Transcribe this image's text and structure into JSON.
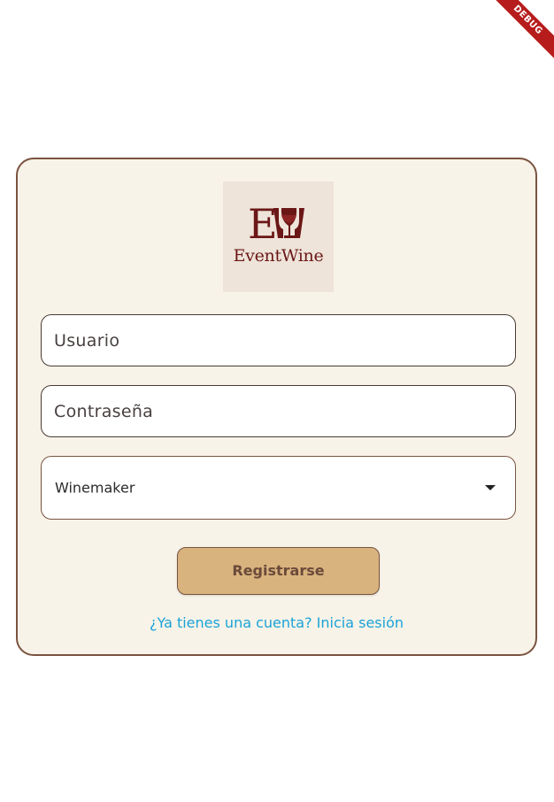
{
  "debug_banner": {
    "label": "DEBUG",
    "color": "#b71c1c"
  },
  "colors": {
    "card_background": "#f8f3e8",
    "card_border": "#7a5340",
    "button_background": "#d9b37e",
    "button_text": "#6b4a3a",
    "link_text": "#1aa3d8",
    "logo_wine": "#6b1717"
  },
  "logo": {
    "monogram": "EW",
    "brand_name": "EventWine",
    "icon": "wine-glass-icon"
  },
  "form": {
    "username_placeholder": "Usuario",
    "password_placeholder": "Contraseña",
    "role_select_value": "Winemaker",
    "role_select_icon": "arrow-drop-down-icon",
    "register_label": "Registrarse",
    "login_link": "¿Ya tienes una cuenta? Inicia sesión"
  }
}
